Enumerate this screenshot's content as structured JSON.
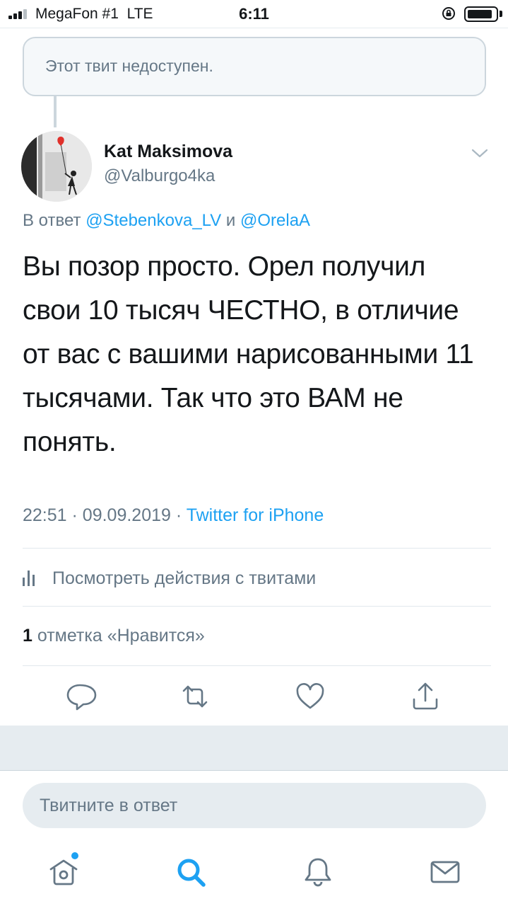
{
  "status_bar": {
    "carrier": "MegaFon #1",
    "network": "LTE",
    "time": "6:11"
  },
  "quoted": {
    "unavailable_text": "Этот твит недоступен."
  },
  "tweet": {
    "author_name": "Kat Maksimova",
    "author_handle": "@Valburgo4ka",
    "reply_prefix": "В ответ",
    "reply_mention_1": "@Stebenkova_LV",
    "reply_conj": "и",
    "reply_mention_2": "@OrelaA",
    "text_lines": [
      "Вы позор просто. Орел получил",
      "свои 10 тысяч ЧЕСТНО, в отличие",
      "от вас с вашими нарисованными 11",
      "тысячами. Так что это ВАМ не",
      "понять."
    ],
    "time": "22:51",
    "date": "09.09.2019",
    "separator": "·",
    "source": "Twitter for iPhone",
    "activity_label": "Посмотреть действия с твитами",
    "likes_count": "1",
    "likes_label": "отметка «Нравится»"
  },
  "reply_box": {
    "placeholder": "Твитните в ответ"
  },
  "icons": {
    "signal": "signal-bars-icon",
    "orientation": "orientation-lock-icon",
    "battery": "battery-icon",
    "caret": "chevron-down-icon",
    "activity": "bar-chart-icon",
    "reply": "reply-icon",
    "retweet": "retweet-icon",
    "like": "heart-icon",
    "share": "share-icon",
    "home": "home-icon",
    "search": "search-icon",
    "notifications": "bell-icon",
    "messages": "mail-icon"
  },
  "colors": {
    "accent": "#1da1f2",
    "text": "#14171a",
    "secondary": "#657786",
    "border": "#e1e8ed"
  }
}
